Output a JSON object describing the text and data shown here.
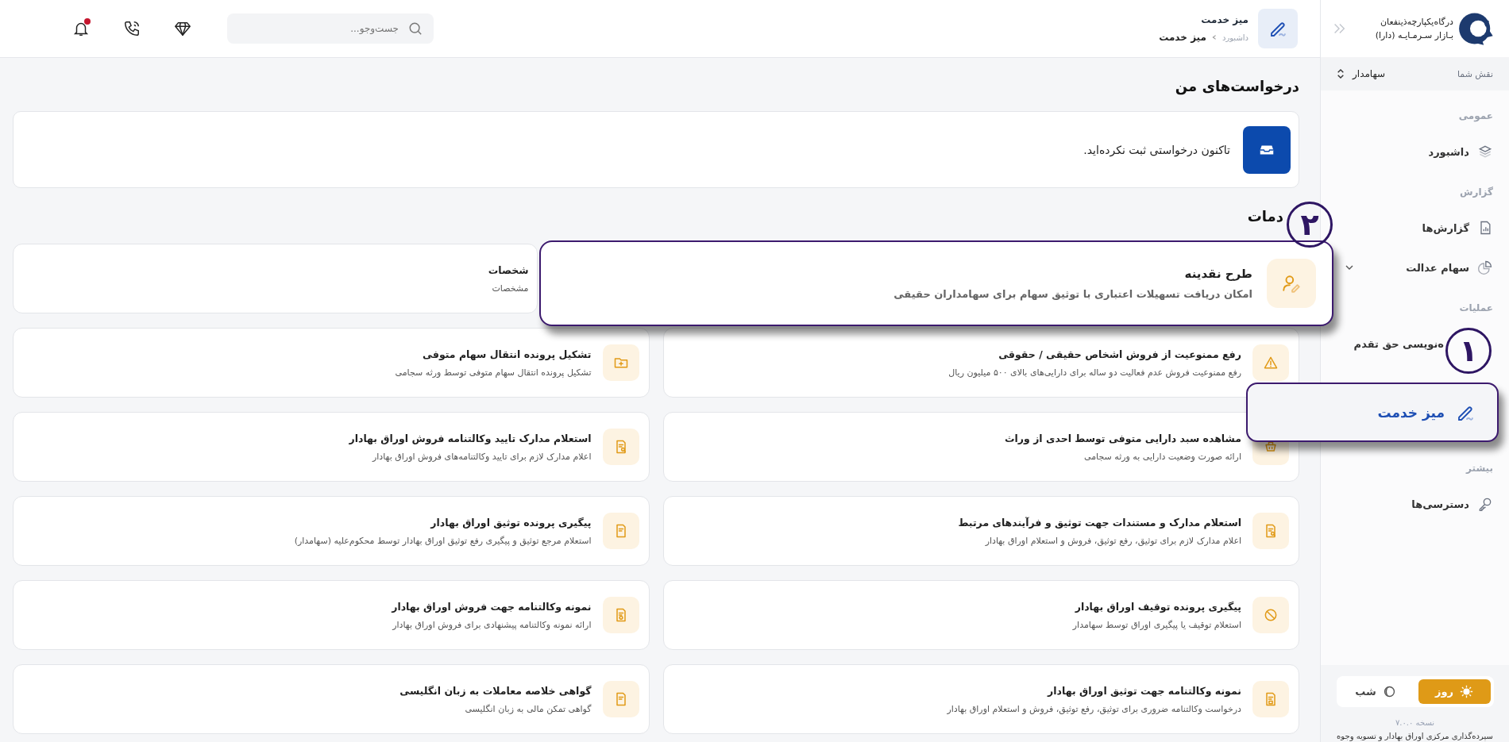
{
  "sidebar": {
    "brand": {
      "line1": "درگاه‌یکپارچه‌ذینفعان",
      "line2": "بـازار سـرمـایـه (دارا)"
    },
    "role": {
      "label": "نقش شما",
      "value": "سهامدار"
    },
    "callout": {
      "label": "۱"
    },
    "sections": [
      {
        "title": "عمومی",
        "items": [
          {
            "label": "داشبورد",
            "kind": "layers",
            "selected": false
          }
        ]
      },
      {
        "title": "گزارش",
        "items": [
          {
            "label": "گزارش‌ها",
            "kind": "chart",
            "selected": false
          },
          {
            "label": "سهام عدالت",
            "kind": "pie",
            "selected": false,
            "expanded": false
          }
        ]
      },
      {
        "title": "عملیات",
        "items": [
          {
            "label": "ه‌نویسی حق تقدم",
            "selected": false,
            "partly_hidden": true
          },
          {
            "label": "میز خدمت",
            "kind": "pen",
            "selected": true,
            "highlighted": true
          }
        ]
      },
      {
        "title": "بیشتر",
        "items": [
          {
            "label": "دسترسی‌ها",
            "kind": "key",
            "selected": false
          }
        ]
      }
    ],
    "theme": [
      {
        "label": "روز",
        "kind": "sun",
        "selected": true
      },
      {
        "label": "شب",
        "kind": "moon",
        "selected": false
      }
    ],
    "version": "نسخه ۷.۰.۰",
    "footer": "سپرده‌گذاری مرکزی اوراق بهادار و تسویه وجوه"
  },
  "header": {
    "title": "میز خدمت",
    "breadcrumb": [
      "داشبورد",
      "میز خدمت"
    ],
    "search": {
      "placeholder": "جست‌وجو..."
    },
    "notifications_unread": true
  },
  "requests": {
    "title": "درخواست‌های من",
    "empty_message": "تاکنون درخواستی ثبت نکرده‌اید."
  },
  "services": {
    "title": "دمات",
    "callout": {
      "label": "۲"
    },
    "cards": [
      {
        "title": "طرح نقدینه",
        "description": "امکان دریافت تسهیلات اعتباری با توثیق سهام برای سهامداران حقیقی",
        "kind": "user-pen",
        "highlighted": true
      },
      {
        "title": "شخصات",
        "description": "مشخصات",
        "partly_hidden": true
      },
      {
        "title": "رفع ممنوعیت از فروش اشخاص حقیقی / حقوقی",
        "description": "رفع ممنوعیت فروش عدم فعالیت دو ساله برای دارایی‌های بالای ۵۰۰ میلیون ریال",
        "kind": "warning"
      },
      {
        "title": "تشکیل پرونده انتقال سهام متوفی",
        "description": "تشکیل پرونده انتقال سهام متوفی توسط ورثه سجامی",
        "kind": "folder"
      },
      {
        "title": "مشاهده سبد دارایی متوفی توسط احدی از وراث",
        "description": "ارائه صورت وضعیت دارایی به ورثه سجامی",
        "kind": "basket"
      },
      {
        "title": "استعلام مدارک تایید وکالتنامه فروش اوراق بهادار",
        "description": "اعلام مدارک لازم برای تایید وکالتنامه‌های فروش اوراق بهادار",
        "kind": "doc-search"
      },
      {
        "title": "استعلام مدارک و مستندات جهت توثیق و فرآیندهای مرتبط",
        "description": "اعلام مدارک لازم برای توثیق، رفع توثیق، فروش و استعلام اوراق بهادار",
        "kind": "doc-search"
      },
      {
        "title": "پیگیری پرونده توثیق اوراق بهادار",
        "description": "استعلام مرجع توثیق و پیگیری رفع توثیق اوراق بهادار توسط محکوم‌علیه (سهامدار)",
        "kind": "doc"
      },
      {
        "title": "پیگیری پرونده توقیف اوراق بهادار",
        "description": "استعلام توقیف یا پیگیری اوراق توسط سهامدار",
        "kind": "ban"
      },
      {
        "title": "نمونه وکالتنامه جهت فروش اوراق بهادار",
        "description": "ارائه نمونه وکالتنامه پیشنهادی برای فروش اوراق بهادار",
        "kind": "doc-coin"
      },
      {
        "title": "نمونه وکالتنامه جهت توثیق اوراق بهادار",
        "description": "درخواست وکالتنامه ضروری برای توثیق، رفع توثیق، فروش و استعلام اوراق بهادار",
        "kind": "doc-lock"
      },
      {
        "title": "گواهی خلاصه معاملات به زبان انگلیسی",
        "description": "گواهی تمکن مالی به زبان انگلیسی",
        "kind": "doc"
      }
    ]
  }
}
